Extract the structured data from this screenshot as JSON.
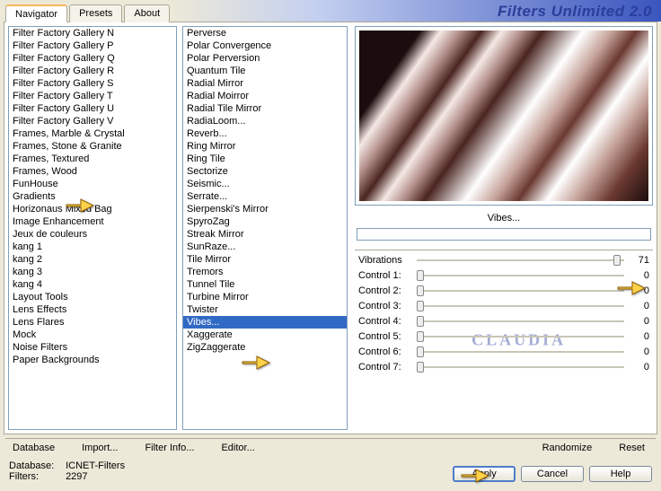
{
  "title": "Filters Unlimited 2.0",
  "tabs": [
    "Navigator",
    "Presets",
    "About"
  ],
  "active_tab": 0,
  "left_list": {
    "items": [
      "Filter Factory Gallery N",
      "Filter Factory Gallery P",
      "Filter Factory Gallery Q",
      "Filter Factory Gallery R",
      "Filter Factory Gallery S",
      "Filter Factory Gallery T",
      "Filter Factory Gallery U",
      "Filter Factory Gallery V",
      "Frames, Marble & Crystal",
      "Frames, Stone & Granite",
      "Frames, Textured",
      "Frames, Wood",
      "FunHouse",
      "Gradients",
      "Horizonaus Mixed Bag",
      "Image Enhancement",
      "Jeux de couleurs",
      "kang 1",
      "kang 2",
      "kang 3",
      "kang 4",
      "Layout Tools",
      "Lens Effects",
      "Lens Flares",
      "Mock",
      "Noise Filters",
      "Paper Backgrounds"
    ],
    "highlighted_index": 12
  },
  "right_list": {
    "items": [
      "Perverse",
      "Polar Convergence",
      "Polar Perversion",
      "Quantum Tile",
      "Radial Mirror",
      "Radial Moirror",
      "Radial Tile Mirror",
      "RadiaLoom...",
      "Reverb...",
      "Ring Mirror",
      "Ring Tile",
      "Sectorize",
      "Seismic...",
      "Serrate...",
      "Sierpenski's Mirror",
      "SpyroZag",
      "Streak Mirror",
      "SunRaze...",
      "Tile Mirror",
      "Tremors",
      "Tunnel Tile",
      "Turbine Mirror",
      "Twister",
      "Vibes...",
      "Xaggerate",
      "ZigZaggerate"
    ],
    "selected_index": 23
  },
  "preview": {
    "label": "Vibes..."
  },
  "controls": [
    {
      "label": "Vibrations",
      "value": 71,
      "pos": 95
    },
    {
      "label": "Control 1:",
      "value": 0,
      "pos": 0
    },
    {
      "label": "Control 2:",
      "value": 0,
      "pos": 0
    },
    {
      "label": "Control 3:",
      "value": 0,
      "pos": 0
    },
    {
      "label": "Control 4:",
      "value": 0,
      "pos": 0
    },
    {
      "label": "Control 5:",
      "value": 0,
      "pos": 0
    },
    {
      "label": "Control 6:",
      "value": 0,
      "pos": 0
    },
    {
      "label": "Control 7:",
      "value": 0,
      "pos": 0
    }
  ],
  "links": {
    "database": "Database",
    "import": "Import...",
    "filter_info": "Filter Info...",
    "editor": "Editor...",
    "randomize": "Randomize",
    "reset": "Reset"
  },
  "status": {
    "database_label": "Database:",
    "database_value": "ICNET-Filters",
    "filters_label": "Filters:",
    "filters_value": "2297"
  },
  "buttons": {
    "apply": "Apply",
    "cancel": "Cancel",
    "help": "Help"
  },
  "watermark": "CLAUDIA"
}
